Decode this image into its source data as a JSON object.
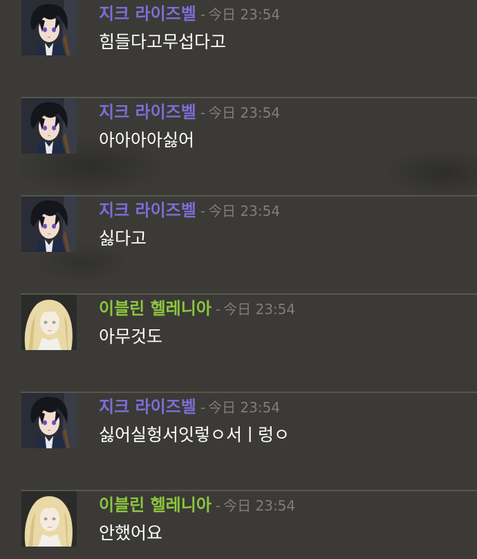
{
  "colors": {
    "background": "#3b3a36",
    "divider": "#57564f",
    "timestamp": "#7f7e78",
    "message_text": "#ffffff"
  },
  "messages": [
    {
      "author": "지크 라이즈벨",
      "author_color": "#7b6fd6",
      "avatar": "dark-haired-boy-avatar",
      "separator": "-",
      "timestamp": "今日 23:54",
      "text": "힘들다고무섭다고"
    },
    {
      "author": "지크 라이즈벨",
      "author_color": "#7b6fd6",
      "avatar": "dark-haired-boy-avatar",
      "separator": "-",
      "timestamp": "今日 23:54",
      "text": "아아아아싫어"
    },
    {
      "author": "지크 라이즈벨",
      "author_color": "#7b6fd6",
      "avatar": "dark-haired-boy-avatar",
      "separator": "-",
      "timestamp": "今日 23:54",
      "text": "싫다고"
    },
    {
      "author": "이블린 헬레니아",
      "author_color": "#8cc63f",
      "avatar": "blonde-girl-avatar",
      "separator": "-",
      "timestamp": "今日 23:54",
      "text": "아무것도"
    },
    {
      "author": "지크 라이즈벨",
      "author_color": "#7b6fd6",
      "avatar": "dark-haired-boy-avatar",
      "separator": "-",
      "timestamp": "今日 23:54",
      "text": "싫어실헝서잇렇ㅇ서ㅣ렁ㅇ"
    },
    {
      "author": "이블린 헬레니아",
      "author_color": "#8cc63f",
      "avatar": "blonde-girl-avatar",
      "separator": "-",
      "timestamp": "今日 23:54",
      "text": "안했어요"
    }
  ]
}
